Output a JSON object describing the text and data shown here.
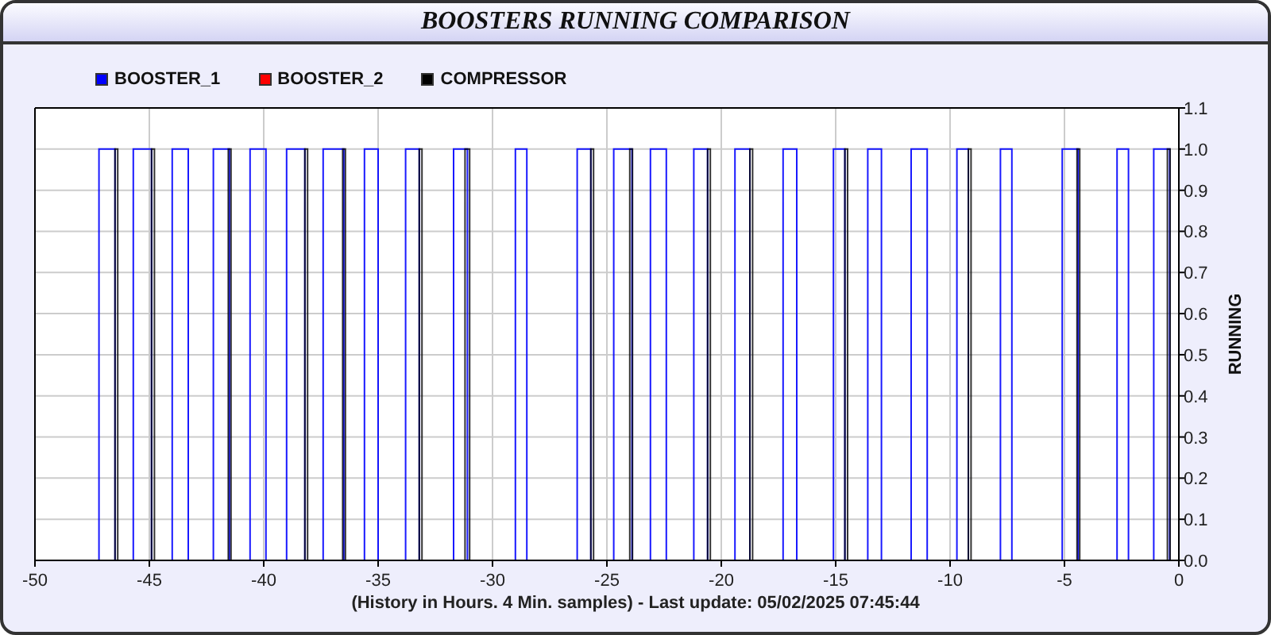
{
  "title": "BOOSTERS RUNNING COMPARISON",
  "chart": {
    "chart_data": {
      "type": "line",
      "grid": true,
      "ylabel": "RUNNING",
      "xlim": [
        -50,
        0
      ],
      "ylim": [
        0,
        1.1
      ],
      "xticks": [
        -50,
        -45,
        -40,
        -35,
        -30,
        -25,
        -20,
        -15,
        -10,
        -5,
        0
      ],
      "yticks": [
        {
          "value": 0,
          "label": "0.0"
        },
        {
          "value": 0.1,
          "label": "0.1"
        },
        {
          "value": 0.2,
          "label": "0.2"
        },
        {
          "value": 0.3,
          "label": "0.3"
        },
        {
          "value": 0.4,
          "label": "0.4"
        },
        {
          "value": 0.5,
          "label": "0.5"
        },
        {
          "value": 0.6,
          "label": "0.6"
        },
        {
          "value": 0.7,
          "label": "0.7"
        },
        {
          "value": 0.8,
          "label": "0.8"
        },
        {
          "value": 0.9,
          "label": "0.9"
        },
        {
          "value": 1,
          "label": "1.0"
        },
        {
          "value": 1.1,
          "label": "1.1"
        }
      ],
      "series": [
        {
          "name": "BOOSTER_1",
          "color": "#0000ff",
          "x": [
            -47.2,
            -47.2,
            -46.5,
            -46.5,
            -45.7,
            -45.7,
            -44.9,
            -44.9,
            -44.0,
            -44.0,
            -43.3,
            -43.3,
            -42.2,
            -42.2,
            -41.5,
            -41.5,
            -40.6,
            -40.6,
            -39.9,
            -39.9,
            -39.0,
            -39.0,
            -38.2,
            -38.2,
            -37.4,
            -37.4,
            -36.5,
            -36.5,
            -35.6,
            -35.6,
            -35.0,
            -35.0,
            -33.8,
            -33.8,
            -33.2,
            -33.2,
            -31.7,
            -31.7,
            -31.1,
            -31.1,
            -29.0,
            -29.0,
            -28.5,
            -28.5,
            -26.3,
            -26.3,
            -25.7,
            -25.7,
            -24.7,
            -24.7,
            -23.9,
            -23.9,
            -23.1,
            -23.1,
            -22.4,
            -22.4,
            -21.2,
            -21.2,
            -20.6,
            -20.6,
            -19.4,
            -19.4,
            -18.75,
            -18.75,
            -17.3,
            -17.3,
            -16.7,
            -16.7,
            -15.1,
            -15.1,
            -14.6,
            -14.6,
            -13.6,
            -13.6,
            -13.0,
            -13.0,
            -11.7,
            -11.7,
            -11.0,
            -11.0,
            -9.7,
            -9.7,
            -9.2,
            -9.2,
            -7.8,
            -7.8,
            -7.3,
            -7.3,
            -5.1,
            -5.1,
            -4.4,
            -4.4,
            -2.7,
            -2.7,
            -2.2,
            -2.2,
            -1.1,
            -1.1,
            -0.4,
            -0.4
          ],
          "values": [
            0,
            1,
            1,
            0,
            0,
            1,
            1,
            0,
            0,
            1,
            1,
            0,
            0,
            1,
            1,
            0,
            0,
            1,
            1,
            0,
            0,
            1,
            1,
            0,
            0,
            1,
            1,
            0,
            0,
            1,
            1,
            0,
            0,
            1,
            1,
            0,
            0,
            1,
            1,
            0,
            0,
            1,
            1,
            0,
            0,
            1,
            1,
            0,
            0,
            1,
            1,
            0,
            0,
            1,
            1,
            0,
            0,
            1,
            1,
            0,
            0,
            1,
            1,
            0,
            0,
            1,
            1,
            0,
            0,
            1,
            1,
            0,
            0,
            1,
            1,
            0,
            0,
            1,
            1,
            0,
            0,
            1,
            1,
            0,
            0,
            1,
            1,
            0,
            0,
            1,
            1,
            0,
            0,
            1,
            1,
            0,
            0,
            1,
            1,
            0
          ]
        },
        {
          "name": "BOOSTER_2",
          "color": "#ff0000"
        },
        {
          "name": "COMPRESSOR",
          "color": "#000000",
          "x": [
            -46.5,
            -46.5,
            -46.38,
            -46.38,
            -44.9,
            -44.9,
            -44.78,
            -44.78,
            -41.55,
            -41.55,
            -41.43,
            -41.43,
            -38.2,
            -38.2,
            -38.08,
            -38.08,
            -36.55,
            -36.55,
            -36.43,
            -36.43,
            -33.2,
            -33.2,
            -33.08,
            -33.08,
            -31.2,
            -31.2,
            -31.0,
            -31.0,
            -25.7,
            -25.7,
            -25.58,
            -25.58,
            -24.0,
            -24.0,
            -23.88,
            -23.88,
            -20.6,
            -20.6,
            -20.48,
            -20.48,
            -18.75,
            -18.75,
            -18.63,
            -18.63,
            -14.6,
            -14.6,
            -14.48,
            -14.48,
            -9.2,
            -9.2,
            -9.08,
            -9.08,
            -4.45,
            -4.45,
            -4.33,
            -4.33,
            -0.5,
            -0.5,
            -0.38,
            -0.38
          ],
          "values": [
            0,
            1,
            1,
            0,
            0,
            1,
            1,
            0,
            0,
            1,
            1,
            0,
            0,
            1,
            1,
            0,
            0,
            1,
            1,
            0,
            0,
            1,
            1,
            0,
            0,
            1,
            1,
            0,
            0,
            1,
            1,
            0,
            0,
            1,
            1,
            0,
            0,
            1,
            1,
            0,
            0,
            1,
            1,
            0,
            0,
            1,
            1,
            0,
            0,
            1,
            1,
            0,
            0,
            1,
            1,
            0,
            0,
            1,
            1,
            0
          ]
        }
      ]
    },
    "caption": "(History in Hours. 4 Min. samples) - Last update: 05/02/2025 07:45:44"
  }
}
